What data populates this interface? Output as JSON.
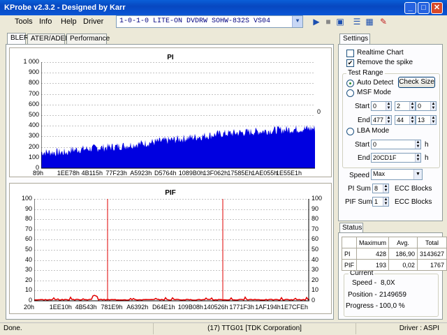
{
  "window": {
    "title": "KProbe v2.3.2 - Designed by Karr",
    "min": "_",
    "max": "□",
    "close": "✕"
  },
  "menu": {
    "tools": "Tools",
    "info": "Info",
    "help": "Help",
    "driver": "Driver"
  },
  "drive": {
    "selected": "1-0-1-0 LITE-ON DVDRW SOHW-832S  VS04"
  },
  "tabs": {
    "bler": "BLER",
    "ater": "ATER/ADER",
    "performance": "Performance"
  },
  "pi_chart": {
    "title": "PI",
    "yticks": [
      "1 000",
      "900",
      "800",
      "700",
      "600",
      "500",
      "400",
      "300",
      "200",
      "100",
      "0"
    ],
    "right_tick": "0",
    "xticks": [
      "89h",
      "1EE78h",
      "4B115h",
      "77F23h",
      "A5923h",
      "D5764h",
      "1089B0h",
      "13F062h",
      "17585Eh",
      "1AE055h",
      "1E55E1h"
    ]
  },
  "pif_chart": {
    "title": "PIF",
    "yticks": [
      "100",
      "90",
      "80",
      "70",
      "60",
      "50",
      "40",
      "30",
      "20",
      "10",
      "0"
    ],
    "xticks": [
      "20h",
      "1EE10h",
      "4B543h",
      "781E9h",
      "A6392h",
      "D64E1h",
      "109B08h",
      "140526h",
      "1771F3h",
      "1AF194h",
      "1E7CFEh"
    ]
  },
  "settings": {
    "tab": "Settings",
    "realtime": "Realtime Chart",
    "remove_spike": "Remove the spike",
    "test_range": "Test Range",
    "auto_detect": "Auto Detect",
    "check_size": "Check Size",
    "msf_mode": "MSF Mode",
    "start_label": "Start",
    "end_label": "End",
    "msf_start": [
      "0",
      "2",
      "0"
    ],
    "msf_end": [
      "477",
      "44",
      "13"
    ],
    "lba_mode": "LBA Mode",
    "lba_start": "0",
    "lba_end": "20CD1F",
    "h_unit": "h",
    "speed_label": "Speed",
    "speed_value": "Max",
    "pi_sum_label": "PI Sum",
    "pi_sum_value": "8",
    "pif_sum_label": "PIF Sum",
    "pif_sum_value": "1",
    "ecc_blocks": "ECC Blocks"
  },
  "status": {
    "tab": "Status",
    "headers": [
      "",
      "Maximum",
      "Avg.",
      "Total"
    ],
    "rows": [
      [
        "PI",
        "428",
        "186,90",
        "3143627"
      ],
      [
        "PIF",
        "193",
        "0,02",
        "1767"
      ]
    ],
    "current": "Current",
    "speed_label": "Speed -",
    "speed_value": "8,0X",
    "position_label": "Position -",
    "position_value": "2149659",
    "progress_label": "Progress -",
    "progress_value": "100,0 %"
  },
  "statusbar": {
    "left": "Done.",
    "center": "(17) TTG01 [TDK Corporation]",
    "right": "Driver : ASPI"
  },
  "colors": {
    "pi_fill": "#0000e0",
    "pif_line": "#e00000",
    "titlebar": "#0a56d6"
  }
}
